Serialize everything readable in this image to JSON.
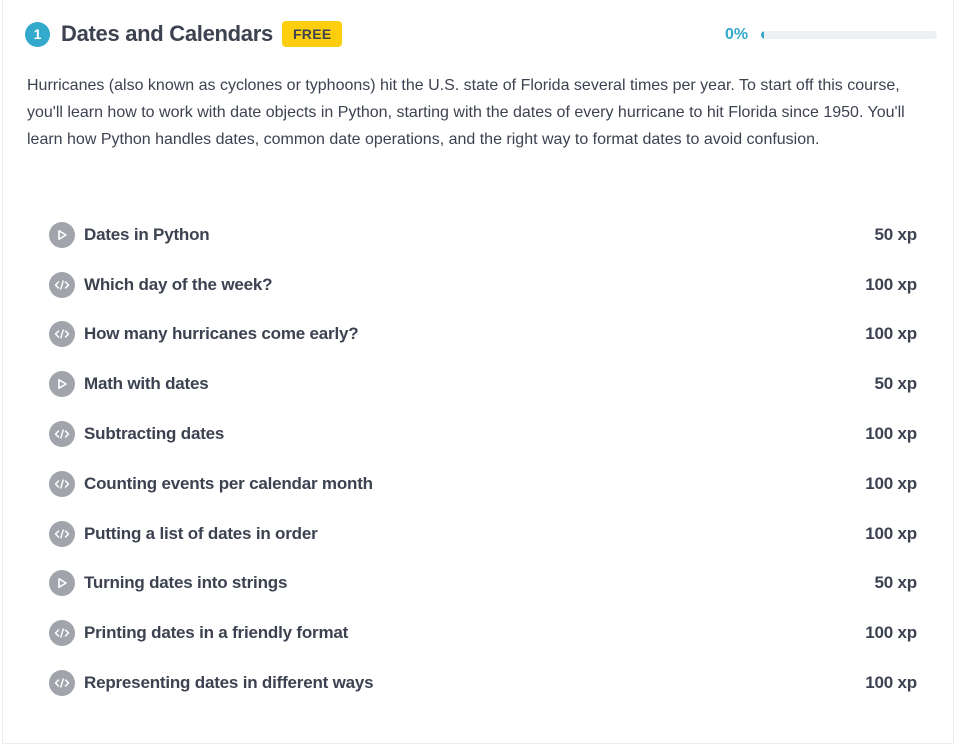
{
  "chapter": {
    "number": "1",
    "title": "Dates and Calendars",
    "badge": "FREE",
    "progress_text": "0%",
    "progress_fraction": 0,
    "description": "Hurricanes (also known as cyclones or typhoons) hit the U.S. state of Florida several times per year. To start off this course, you'll learn how to work with date objects in Python, starting with the dates of every hurricane to hit Florida since 1950. You'll learn how Python handles dates, common date operations, and the right way to format dates to avoid confusion."
  },
  "colors": {
    "accent": "#33aacc",
    "badge": "#fcce0d",
    "icon_bg": "#a1a5ab",
    "text": "#3d4251"
  },
  "exercises": [
    {
      "icon": "video-play-icon",
      "title": "Dates in Python",
      "xp": "50 xp"
    },
    {
      "icon": "code-icon",
      "title": "Which day of the week?",
      "xp": "100 xp"
    },
    {
      "icon": "code-icon",
      "title": "How many hurricanes come early?",
      "xp": "100 xp"
    },
    {
      "icon": "video-play-icon",
      "title": "Math with dates",
      "xp": "50 xp"
    },
    {
      "icon": "code-icon",
      "title": "Subtracting dates",
      "xp": "100 xp"
    },
    {
      "icon": "code-icon",
      "title": "Counting events per calendar month",
      "xp": "100 xp"
    },
    {
      "icon": "code-icon",
      "title": "Putting a list of dates in order",
      "xp": "100 xp"
    },
    {
      "icon": "video-play-icon",
      "title": "Turning dates into strings",
      "xp": "50 xp"
    },
    {
      "icon": "code-icon",
      "title": "Printing dates in a friendly format",
      "xp": "100 xp"
    },
    {
      "icon": "code-icon",
      "title": "Representing dates in different ways",
      "xp": "100 xp"
    }
  ]
}
